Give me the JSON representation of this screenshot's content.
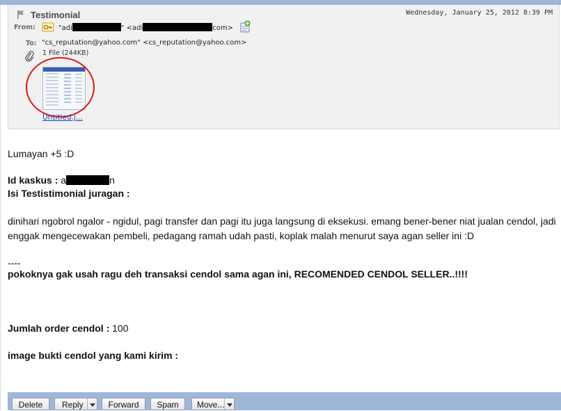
{
  "header": {
    "subject": "Testimonial",
    "date": "Wednesday, January 25, 2012 8:39 PM",
    "from_label": "From:",
    "from_name_prefix": "\"adi",
    "from_mid": "\" <adi",
    "from_suffix": "com>",
    "to_label": "To:",
    "to_value": "\"cs_reputation@yahoo.com\" <cs_reputation@yahoo.com>",
    "attachment_summary": "1 File (244KB)",
    "attachment_name": "Untitled.j..."
  },
  "body": {
    "line1": "Lumayan +5 :D",
    "id_label": "Id kaskus :",
    "id_value_start": "a",
    "id_value_end": "n",
    "testimonial_label": "Isi Testistimonial juragan :",
    "paragraph": "dinihari ngobrol ngalor - ngidul, pagi transfer dan pagi itu juga langsung di eksekusi. emang bener-bener niat jualan cendol, jadi enggak mengecewakan pembeli, pedagang ramah udah pasti, koplak malah menurut saya agan seller ini :D",
    "separator": "----",
    "conclusion": "pokoknya gak usah ragu deh transaksi cendol sama agan ini, RECOMENDED CENDOL SELLER..!!!!",
    "order_label": "Jumlah order cendol :",
    "order_value": "100",
    "image_label": "image bukti cendol yang kami kirim :"
  },
  "toolbar": {
    "delete_label": "Delete",
    "reply_label": "Reply",
    "forward_label": "Forward",
    "spam_label": "Spam",
    "move_label": "Move..."
  },
  "colors": {
    "toolbar_bg": "#9fb6d8",
    "header_bg": "#f1f1f1",
    "annotation_circle": "#e01818",
    "link": "#1a3fa8"
  },
  "icons": {
    "subject": "flag-icon",
    "from": "key-icon",
    "add_contact": "add-contact-icon",
    "attachment": "paperclip-icon"
  }
}
